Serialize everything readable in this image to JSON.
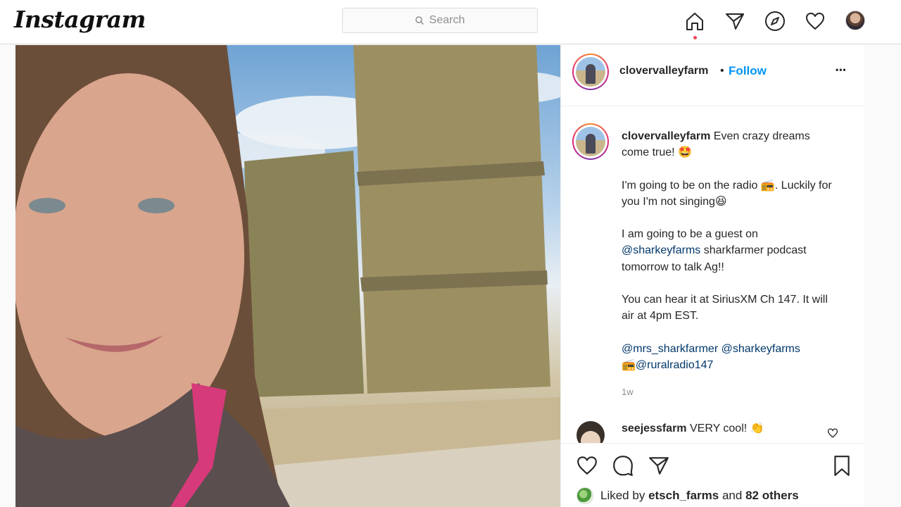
{
  "app": {
    "logo_text": "Instagram"
  },
  "search": {
    "placeholder": "Search"
  },
  "nav": {
    "icons": [
      "home-icon",
      "direct-icon",
      "explore-icon",
      "activity-icon",
      "profile-avatar"
    ],
    "active": "home"
  },
  "post": {
    "username": "clovervalleyfarm",
    "follow_separator": "•",
    "follow_label": "Follow",
    "more_label": "•••",
    "caption": {
      "username": "clovervalleyfarm",
      "line1": "Even crazy dreams come true! 🤩",
      "line2": "I'm going to be on the radio 📻. Luckily for you I'm not singing😆",
      "line3_pre": "I am going to be a guest on",
      "line3_mention": "@sharkeyfarms",
      "line3_post": "sharkfarmer podcast tomorrow to talk Ag!!",
      "line4": "You can hear it at SiriusXM Ch 147. It will air at 4pm EST.",
      "mention1": "@mrs_sharkfarmer",
      "mention2": "@sharkeyfarms",
      "radio_emoji": "📻",
      "mention3": "@ruralradio147"
    },
    "time_ago": "1w",
    "comment": {
      "username": "seejessfarm",
      "text": "VERY cool! 👏"
    },
    "liked_by": {
      "prefix": "Liked by",
      "user": "etsch_farms",
      "middle": "and",
      "others": "82 others"
    }
  },
  "colors": {
    "accent": "#0095f6",
    "mention": "#00376b",
    "notification_dot": "#ed4956",
    "border": "#dbdbdb"
  }
}
